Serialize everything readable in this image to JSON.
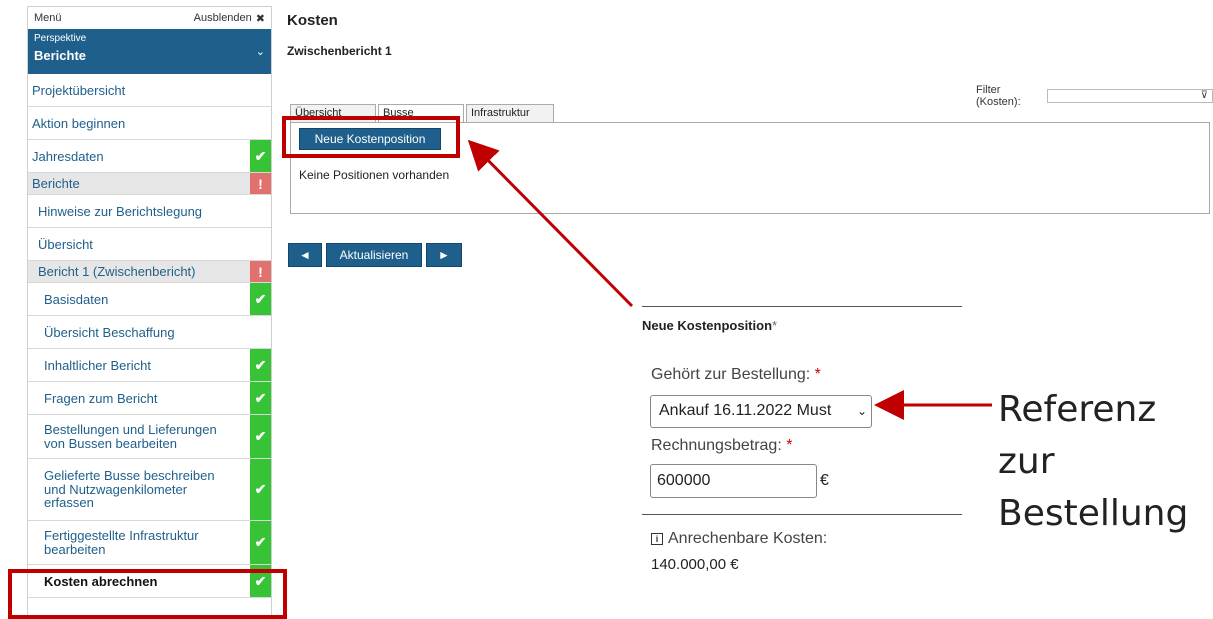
{
  "sidebar": {
    "menu_label": "Menü",
    "hide_label": "Ausblenden",
    "perspective_label": "Perspektive",
    "perspective_value": "Berichte",
    "items": [
      {
        "label": "Projektübersicht"
      },
      {
        "label": "Aktion beginnen"
      },
      {
        "label": "Jahresdaten",
        "status": "ok"
      },
      {
        "label": "Berichte",
        "status": "warn"
      },
      {
        "label": "Hinweise zur Berichtslegung"
      },
      {
        "label": "Übersicht"
      },
      {
        "label": "Bericht 1 (Zwischenbericht)",
        "status": "warn"
      },
      {
        "label": "Basisdaten",
        "status": "ok"
      },
      {
        "label": "Übersicht Beschaffung"
      },
      {
        "label": "Inhaltlicher Bericht",
        "status": "ok"
      },
      {
        "label": "Fragen zum Bericht",
        "status": "ok"
      },
      {
        "label": "Bestellungen und Lieferungen von Bussen bearbeiten",
        "status": "ok"
      },
      {
        "label": "Gelieferte Busse beschreiben und Nutzwagenkilometer erfassen",
        "status": "ok"
      },
      {
        "label": "Fertiggestellte Infrastruktur bearbeiten",
        "status": "ok"
      },
      {
        "label": "Kosten abrechnen",
        "status": "ok"
      }
    ]
  },
  "main": {
    "title": "Kosten",
    "subtitle": "Zwischenbericht 1",
    "filter_label": "Filter (Kosten):",
    "tabs": [
      {
        "label": "Übersicht"
      },
      {
        "label": "Busse"
      },
      {
        "label": "Infrastruktur"
      }
    ],
    "new_button": "Neue Kostenposition",
    "empty_text": "Keine Positionen vorhanden",
    "nav": {
      "prev": "◄",
      "refresh": "Aktualisieren",
      "next": "►"
    }
  },
  "form": {
    "title": "Neue Kostenposition",
    "title_marker": "*",
    "order_label": "Gehört zur Bestellung:",
    "required_marker": "*",
    "order_value": "Ankauf 16.11.2022 Must",
    "amount_label": "Rechnungsbetrag:",
    "amount_value": "600000",
    "currency": "€",
    "eligible_label": "Anrechenbare Kosten:",
    "eligible_value": "140.000,00 €"
  },
  "annotation": {
    "line1": "Referenz zur",
    "line2": "Bestellung"
  },
  "colors": {
    "accent": "#1f5f8b",
    "ok": "#36c436",
    "warn": "#e0716e",
    "highlight": "#c00000"
  },
  "icons": {
    "hide": "close-icon",
    "perspective": "chevron-down-icon",
    "ok": "checkmark-icon",
    "warn": "exclamation-icon",
    "filter": "funnel-icon",
    "info": "info-icon",
    "select": "chevron-down-icon"
  }
}
